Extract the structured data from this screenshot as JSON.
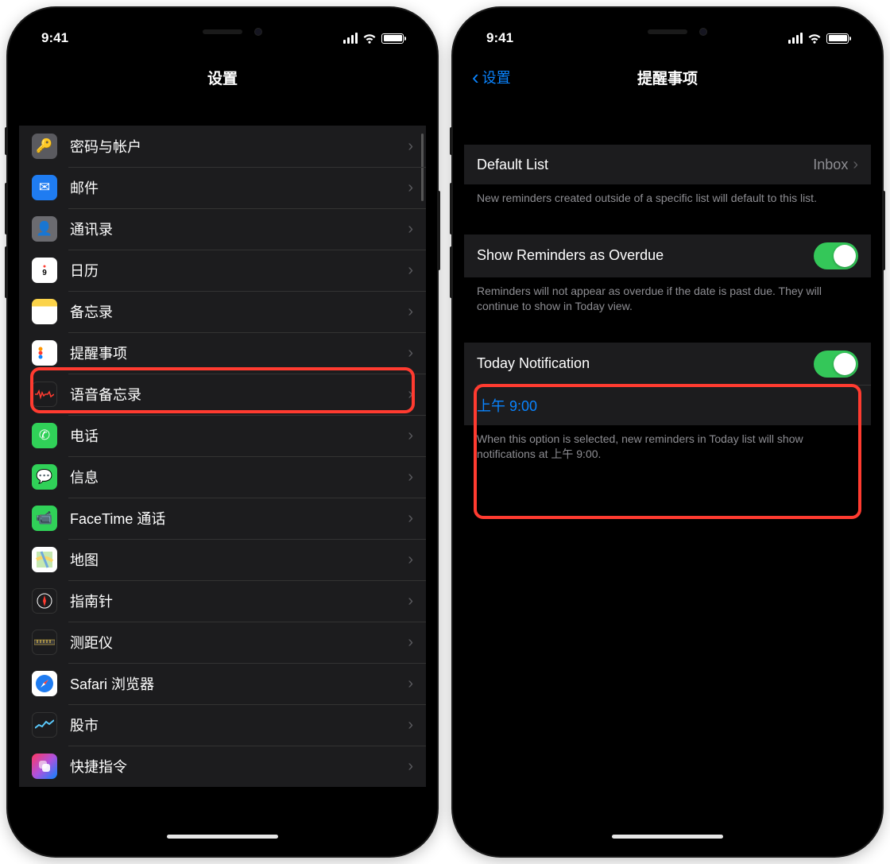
{
  "status": {
    "time": "9:41"
  },
  "left": {
    "title": "设置",
    "items": [
      {
        "label": "密码与帐户",
        "icon": "key-icon"
      },
      {
        "label": "邮件",
        "icon": "mail-icon"
      },
      {
        "label": "通讯录",
        "icon": "contacts-icon"
      },
      {
        "label": "日历",
        "icon": "calendar-icon"
      },
      {
        "label": "备忘录",
        "icon": "notes-icon"
      },
      {
        "label": "提醒事项",
        "icon": "reminders-icon",
        "highlight": true
      },
      {
        "label": "语音备忘录",
        "icon": "voice-memo-icon"
      },
      {
        "label": "电话",
        "icon": "phone-icon"
      },
      {
        "label": "信息",
        "icon": "messages-icon"
      },
      {
        "label": "FaceTime 通话",
        "icon": "facetime-icon"
      },
      {
        "label": "地图",
        "icon": "maps-icon"
      },
      {
        "label": "指南针",
        "icon": "compass-icon"
      },
      {
        "label": "测距仪",
        "icon": "measure-icon"
      },
      {
        "label": "Safari 浏览器",
        "icon": "safari-icon"
      },
      {
        "label": "股市",
        "icon": "stocks-icon"
      },
      {
        "label": "快捷指令",
        "icon": "shortcuts-icon"
      }
    ]
  },
  "right": {
    "back_label": "设置",
    "title": "提醒事项",
    "default_list": {
      "label": "Default List",
      "value": "Inbox"
    },
    "default_list_footer": "New reminders created outside of a specific list will default to this list.",
    "overdue": {
      "label": "Show Reminders as Overdue",
      "on": true
    },
    "overdue_footer": "Reminders will not appear as overdue if the date is past due. They will continue to show in Today view.",
    "today": {
      "label": "Today Notification",
      "on": true,
      "time": "上午 9:00"
    },
    "today_footer": "When this option is selected, new reminders in Today list will show notifications at 上午 9:00."
  }
}
